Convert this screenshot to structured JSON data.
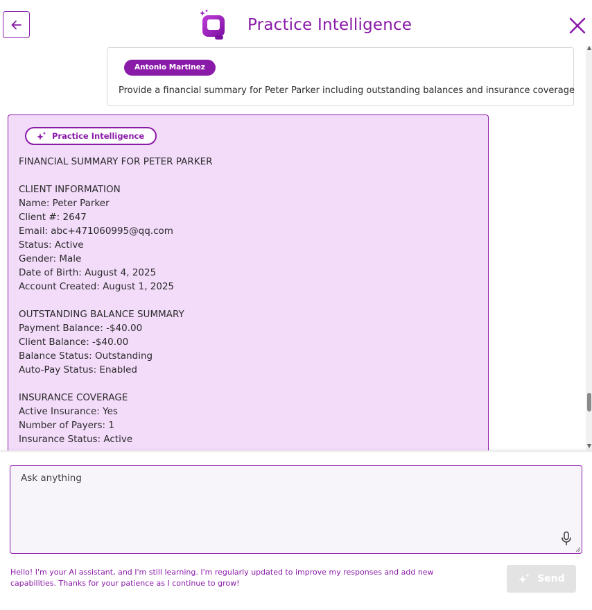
{
  "header": {
    "title": "Practice Intelligence",
    "back_icon": "arrow-left-icon",
    "close_icon": "close-icon",
    "logo_icon": "practice-intelligence-logo"
  },
  "conversation": {
    "user_message": {
      "author": "Antonio Martinez",
      "text": "Provide a financial summary for Peter Parker including outstanding balances and insurance coverage"
    },
    "ai_message": {
      "author": "Practice Intelligence",
      "author_icon": "sparkle-icon",
      "lines": [
        "FINANCIAL SUMMARY FOR PETER PARKER",
        "",
        "CLIENT INFORMATION",
        "Name: Peter Parker",
        "Client #: 2647",
        "Email: abc+471060995@qq.com",
        "Status: Active",
        "Gender: Male",
        "Date of Birth: August 4, 2025",
        "Account Created: August 1, 2025",
        "",
        "OUTSTANDING BALANCE SUMMARY",
        "Payment Balance: -$40.00",
        "Client Balance: -$40.00",
        "Balance Status: Outstanding",
        "Auto-Pay Status: Enabled",
        "",
        "INSURANCE COVERAGE",
        "Active Insurance: Yes",
        "Number of Payers: 1",
        "Insurance Status: Active"
      ]
    }
  },
  "composer": {
    "placeholder": "Ask anything",
    "value": "",
    "mic_icon": "microphone-icon",
    "send_label": "Send",
    "send_icon": "sparkle-icon",
    "disclaimer": "Hello! I'm your AI assistant, and I'm still learning. I'm regularly updated to improve my responses and add new capabilities. Thanks for your patience as I continue to grow!"
  },
  "colors": {
    "accent": "#8a1aa8",
    "ai_bubble_bg": "#f3dbfa",
    "send_disabled_bg": "#e3e3e3"
  }
}
